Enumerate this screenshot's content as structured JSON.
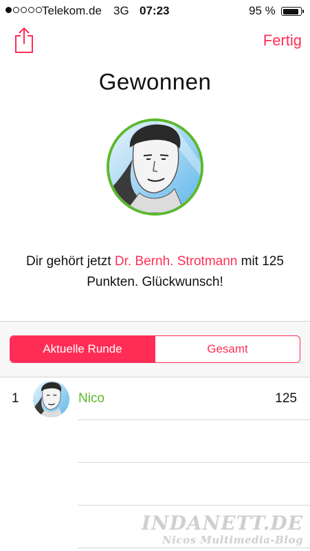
{
  "status_bar": {
    "signal_dots_filled": 1,
    "signal_dots_total": 5,
    "carrier": "Telekom.de",
    "network": "3G",
    "time": "07:23",
    "battery_percent": "95 %",
    "battery_level": 0.95
  },
  "nav": {
    "share_icon": "share-icon",
    "done_label": "Fertig"
  },
  "result": {
    "title": "Gewonnen",
    "message_prefix": "Dir gehört jetzt ",
    "winner_name": "Dr. Bernh. Strotmann",
    "message_suffix": " mit 125 Punkten. Glückwunsch!"
  },
  "tabs": [
    {
      "label": "Aktuelle Runde",
      "selected": true
    },
    {
      "label": "Gesamt",
      "selected": false
    }
  ],
  "ranking": [
    {
      "rank": "1",
      "name": "Nico",
      "score": "125"
    }
  ],
  "watermark": {
    "line1": "INDANETT.DE",
    "line2": "Nicos Multimedia-Blog"
  },
  "colors": {
    "accent": "#ff2d55",
    "winner_green": "#5cb82e"
  }
}
